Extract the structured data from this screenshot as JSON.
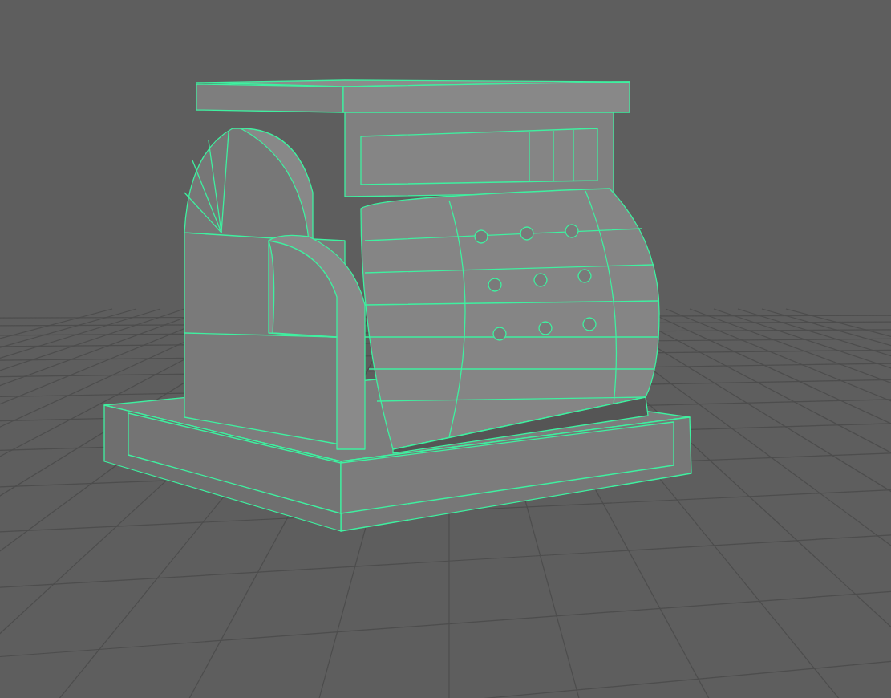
{
  "grid": {
    "visible": true
  },
  "model": {
    "selected": true
  }
}
